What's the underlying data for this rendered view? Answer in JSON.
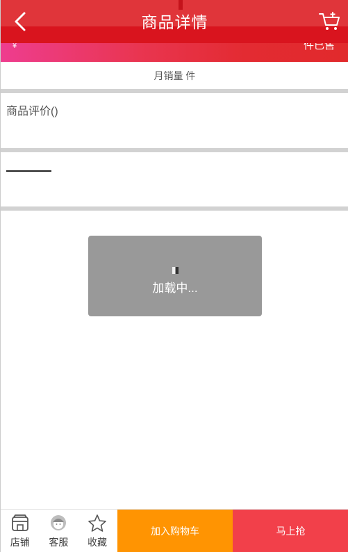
{
  "header": {
    "title": "商品详情",
    "back_icon": "chevron-left-icon",
    "cart_icon": "cart-add-icon"
  },
  "promo": {
    "currency": "¥",
    "sold_text": "件已售"
  },
  "sales": {
    "monthly_text": "月销量 件"
  },
  "reviews": {
    "title": "商品评价()"
  },
  "loading": {
    "text": "加载中..."
  },
  "bottom_bar": {
    "items": [
      {
        "label": "店铺",
        "icon": "store-icon"
      },
      {
        "label": "客服",
        "icon": "customer-service-icon"
      },
      {
        "label": "收藏",
        "icon": "star-icon"
      }
    ],
    "add_to_cart": "加入购物车",
    "buy_now": "马上抢"
  },
  "colors": {
    "header": "#e0353a",
    "add_to_cart": "#ff9402",
    "buy_now": "#f2404a",
    "loading_bg": "#999999"
  }
}
